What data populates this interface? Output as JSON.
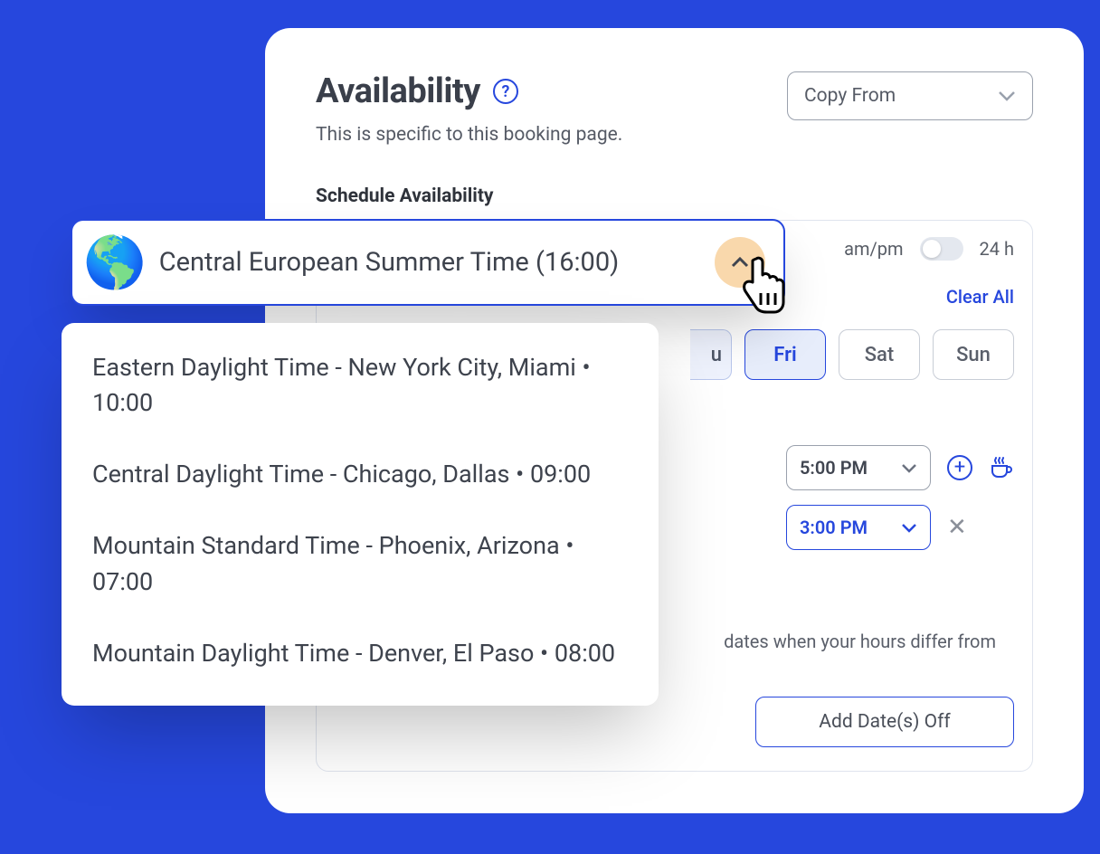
{
  "header": {
    "title": "Availability",
    "help_symbol": "?",
    "subtitle": "This is specific to this booking page.",
    "copy_from_label": "Copy From"
  },
  "section_label": "Schedule Availability",
  "format_toggle": {
    "left": "am/pm",
    "right": "24 h"
  },
  "clear_all": "Clear All",
  "days": {
    "thu_partial": "u",
    "fri": "Fri",
    "sat": "Sat",
    "sun": "Sun"
  },
  "times": {
    "slot1": "5:00 PM",
    "slot2": "3:00 PM"
  },
  "hint": "dates when your hours differ from",
  "add_dates_off": "Add Date(s) Off",
  "timezone": {
    "current": "Central European Summer Time (16:00)",
    "options": [
      "Eastern Daylight Time - New York City, Miami • 10:00",
      "Central Daylight Time - Chicago, Dallas • 09:00",
      "Mountain Standard Time - Phoenix, Arizona • 07:00",
      "Mountain Daylight Time - Denver, El Paso • 08:00"
    ]
  }
}
